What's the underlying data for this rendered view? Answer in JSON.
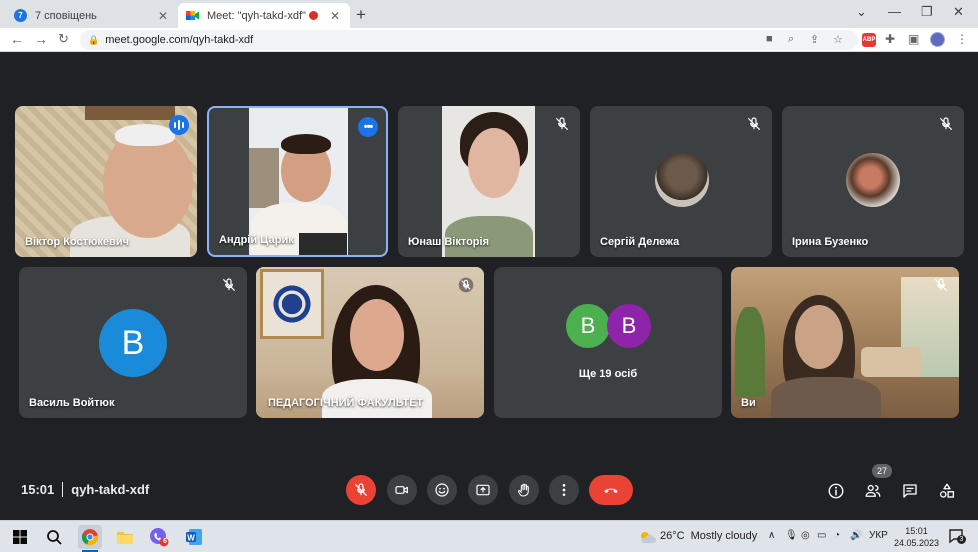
{
  "browser": {
    "tabs": [
      {
        "title": "7 сповіщень",
        "active": false,
        "favicon": "notification-counter-icon",
        "favicon_text": "7"
      },
      {
        "title": "Meet: \"qyh-takd-xdf\"",
        "active": true,
        "favicon": "google-meet-icon",
        "recording": true
      }
    ],
    "new_tab_label": "+",
    "url": "meet.google.com/qyh-takd-xdf"
  },
  "meet": {
    "participants_row1": [
      {
        "name": "Віктор Костюкевич",
        "status": "speaking",
        "video": true
      },
      {
        "name": "Андрій Царик",
        "status": "pinned-focus",
        "video": true
      },
      {
        "name": "Юнаш Вікторія",
        "status": "muted",
        "video": true
      },
      {
        "name": "Сергій Дележа",
        "status": "muted",
        "video": false
      },
      {
        "name": "Ірина Бузенко",
        "status": "muted",
        "video": false
      }
    ],
    "participants_row2": [
      {
        "name": "Василь Войтюк",
        "status": "muted",
        "video": false,
        "avatar_letter": "В",
        "avatar_color": "#1a8bd8"
      },
      {
        "name": "ПЕДАГОГІЧНИЙ ФАКУЛЬТЕТ",
        "status": "muted",
        "video": true
      },
      {
        "name": "Ще 19 осіб",
        "avatars": [
          {
            "letter": "В",
            "color": "#4caf50"
          },
          {
            "letter": "В",
            "color": "#8e24aa"
          }
        ]
      },
      {
        "name": "Ви",
        "status": "muted",
        "video": true
      }
    ],
    "time": "15:01",
    "meeting_code": "qyh-takd-xdf",
    "people_count": "27",
    "accent_red": "#ea4335",
    "accent_blue": "#1a73e8"
  },
  "taskbar": {
    "weather_temp": "26°C",
    "weather_text": "Mostly cloudy",
    "language": "УКР",
    "time": "15:01",
    "date": "24.05.2023",
    "notifications": "3",
    "viber_badge": "6"
  }
}
